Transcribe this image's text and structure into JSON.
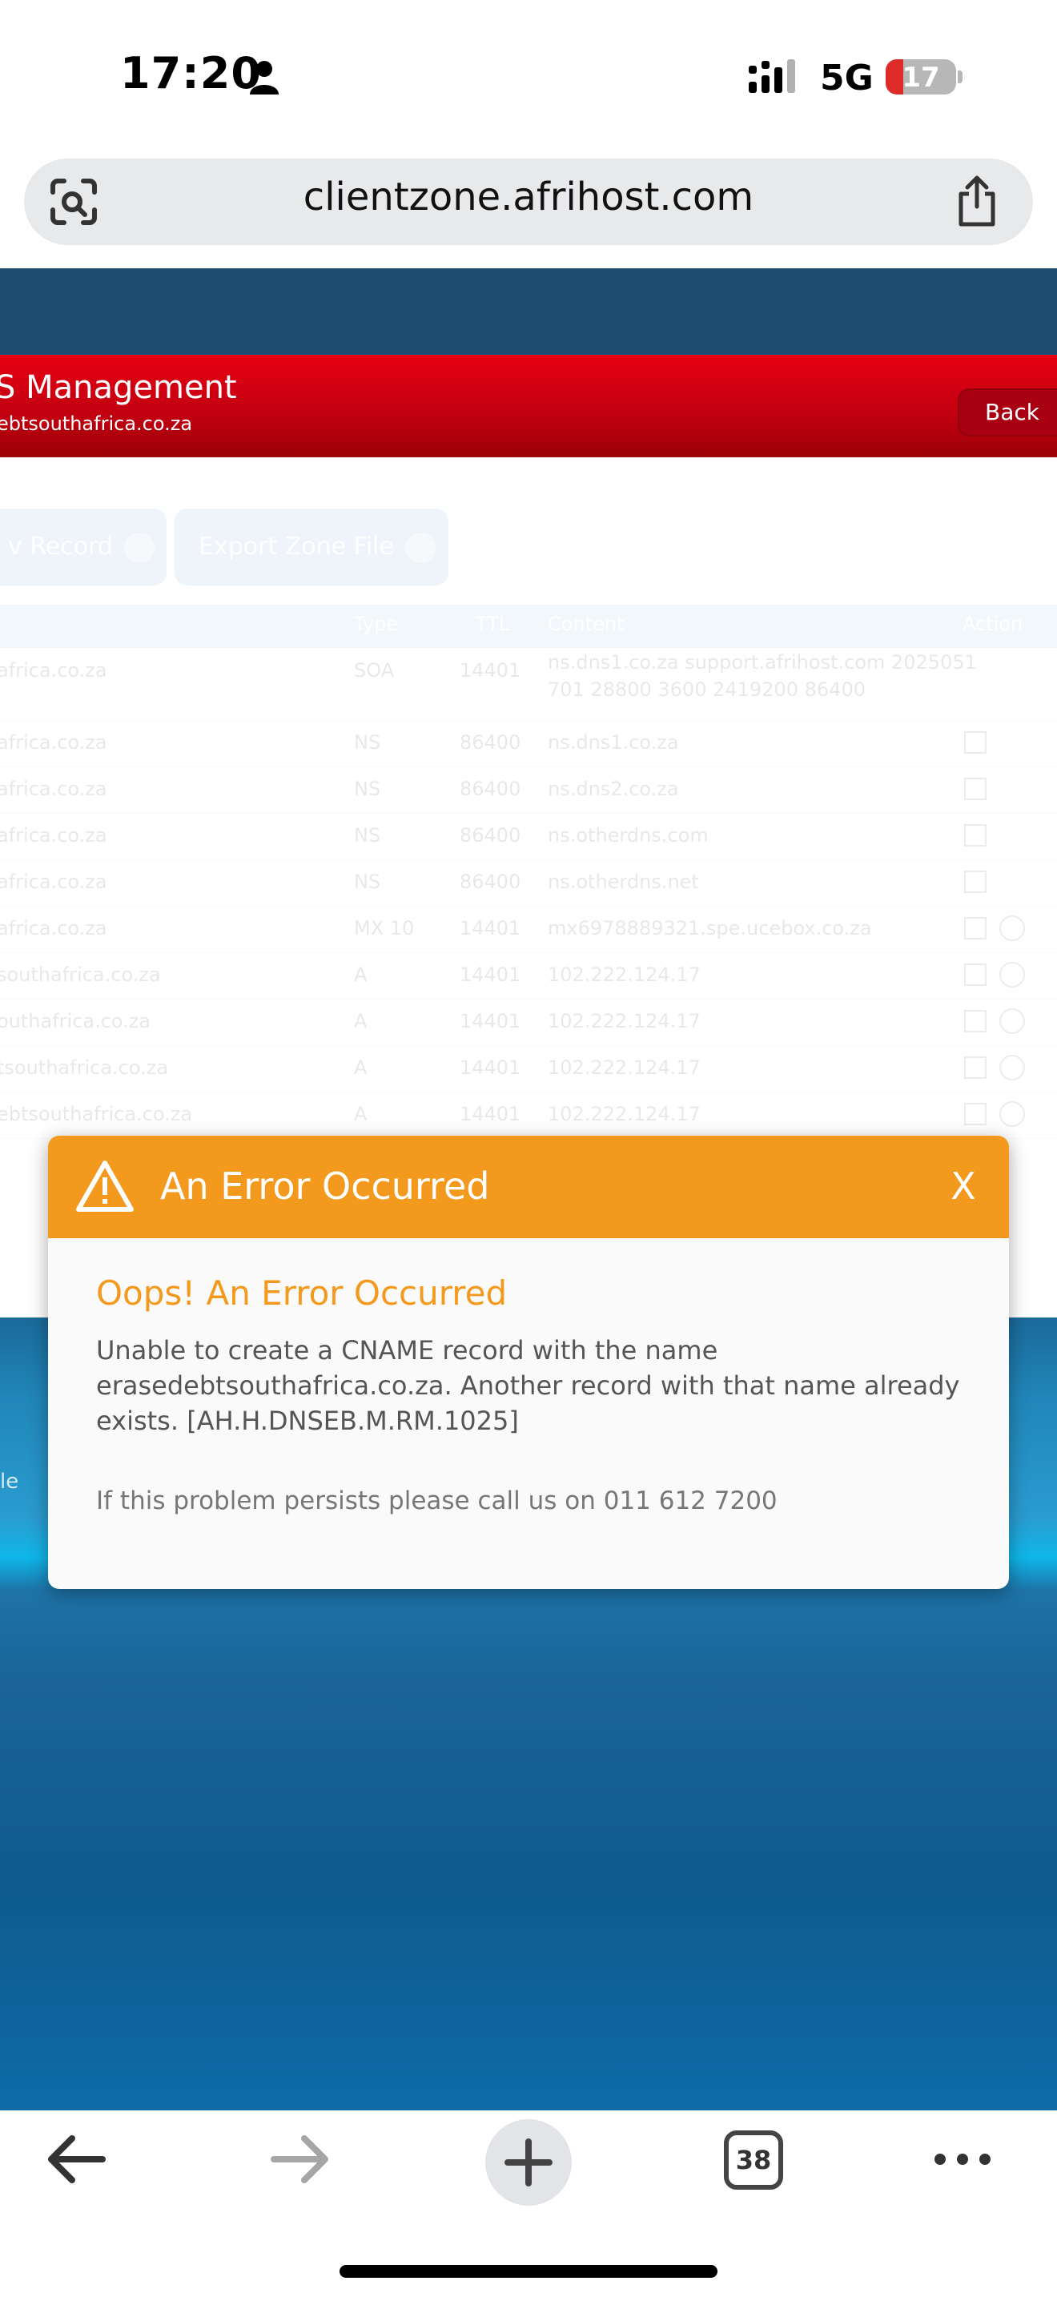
{
  "status_bar": {
    "time": "17:20",
    "network": "5G",
    "battery": "17"
  },
  "browser": {
    "url": "clientzone.afrihost.com",
    "tab_count": "38"
  },
  "page": {
    "header_title": "S Management",
    "header_subtitle": "ebtsouthafrica.co.za",
    "back_label": "Back",
    "buttons": {
      "add_record": "v Record",
      "export_zone": "Export Zone File"
    },
    "table": {
      "columns": {
        "type": "Type",
        "ttl": "TTL",
        "content": "Content",
        "action": "Action"
      },
      "rows": [
        {
          "name": "africa.co.za",
          "type": "SOA",
          "ttl": "14401",
          "content": "ns.dns1.co.za support.afrihost.com 2025051",
          "content2": "701 28800 3600 2419200 86400"
        },
        {
          "name": "africa.co.za",
          "type": "NS",
          "ttl": "86400",
          "content": "ns.dns1.co.za"
        },
        {
          "name": "africa.co.za",
          "type": "NS",
          "ttl": "86400",
          "content": "ns.dns2.co.za"
        },
        {
          "name": "africa.co.za",
          "type": "NS",
          "ttl": "86400",
          "content": "ns.otherdns.com"
        },
        {
          "name": "africa.co.za",
          "type": "NS",
          "ttl": "86400",
          "content": "ns.otherdns.net"
        },
        {
          "name": "africa.co.za",
          "type": "MX 10",
          "ttl": "14401",
          "content": "mx6978889321.spe.ucebox.co.za"
        },
        {
          "name": "southafrica.co.za",
          "type": "A",
          "ttl": "14401",
          "content": "102.222.124.17"
        },
        {
          "name": "outhafrica.co.za",
          "type": "A",
          "ttl": "14401",
          "content": "102.222.124.17"
        },
        {
          "name": "tsouthafrica.co.za",
          "type": "A",
          "ttl": "14401",
          "content": "102.222.124.17"
        },
        {
          "name": "ebtsouthafrica.co.za",
          "type": "A",
          "ttl": "14401",
          "content": "102.222.124.17"
        }
      ]
    },
    "side_text": "le"
  },
  "modal": {
    "title": "An Error Occurred",
    "close_label": "X",
    "heading": "Oops! An Error Occurred",
    "message": "Unable to create a CNAME record with the name erasedebtsouthafrica.co.za. Another record with that name already exists. [AH.H.DNSEB.M.RM.1025]",
    "footer": "If this problem persists please call us on 011 612 7200"
  },
  "colors": {
    "accent_orange": "#f39a1e",
    "header_red": "#e60012",
    "navy": "#1e4c73"
  }
}
